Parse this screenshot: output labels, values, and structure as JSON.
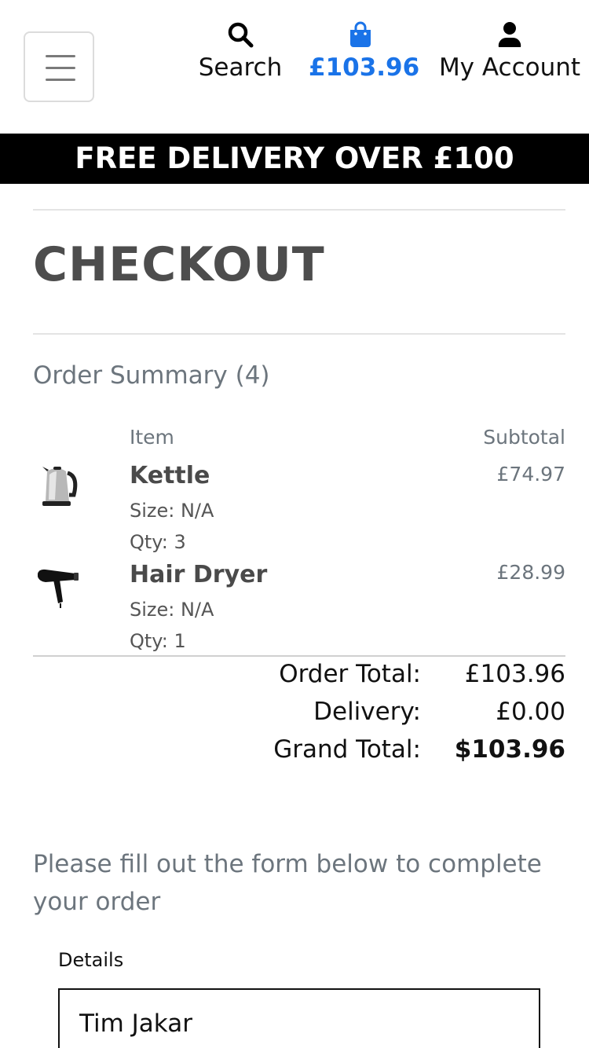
{
  "header": {
    "search_label": "Search",
    "cart_total": "£103.96",
    "account_label": "My Account",
    "icons": {
      "menu": "hamburger-icon",
      "search": "search-icon",
      "cart": "shopping-bag-icon",
      "account": "user-icon"
    },
    "accent_color": "#1a73e8"
  },
  "banner": {
    "text": "FREE DELIVERY OVER £100"
  },
  "page": {
    "title": "CHECKOUT"
  },
  "summary": {
    "title": "Order Summary (4)",
    "col_item": "Item",
    "col_subtotal": "Subtotal",
    "items": [
      {
        "name": "Kettle",
        "size": "Size: N/A",
        "qty": "Qty: 3",
        "subtotal": "£74.97",
        "image": "kettle-image"
      },
      {
        "name": "Hair Dryer",
        "size": "Size: N/A",
        "qty": "Qty: 1",
        "subtotal": "£28.99",
        "image": "hair-dryer-image"
      }
    ],
    "order_total_label": "Order Total:",
    "order_total": "£103.96",
    "delivery_label": "Delivery:",
    "delivery": "£0.00",
    "grand_total_label": "Grand Total:",
    "grand_total": "$103.96"
  },
  "form": {
    "intro": "Please fill out the form below to complete your order",
    "legend": "Details",
    "full_name_value": "Tim Jakar"
  }
}
